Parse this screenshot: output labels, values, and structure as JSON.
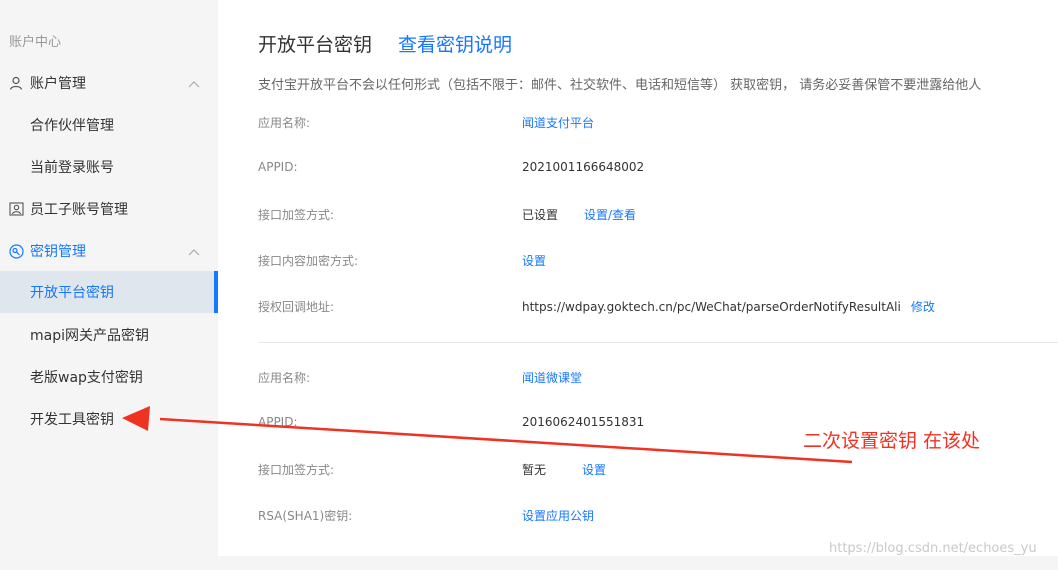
{
  "sidebar": {
    "header": "账户中心",
    "groups": [
      {
        "label": "账户管理",
        "icon": "user-icon"
      },
      {
        "label": "员工子账号管理",
        "icon": "staff-icon"
      },
      {
        "label": "密钥管理",
        "icon": "key-icon"
      }
    ],
    "items": [
      {
        "label": "合作伙伴管理"
      },
      {
        "label": "当前登录账号"
      },
      {
        "label": "开放平台密钥"
      },
      {
        "label": "mapi网关产品密钥"
      },
      {
        "label": "老版wap支付密钥"
      },
      {
        "label": "开发工具密钥"
      }
    ]
  },
  "main": {
    "title": "开放平台密钥",
    "title_link": "查看密钥说明",
    "description": "支付宝开放平台不会以任何形式（包括不限于：邮件、社交软件、电话和短信等） 获取密钥， 请务必妥善保管不要泄露给他人",
    "apps": [
      {
        "rows": [
          {
            "label": "应用名称:",
            "value": "闻道支付平台"
          },
          {
            "label": "APPID:",
            "value": "2021001166648002"
          },
          {
            "label": "接口加签方式:",
            "value": "已设置",
            "action": "设置/查看"
          },
          {
            "label": "接口内容加密方式:",
            "value": "设置"
          },
          {
            "label": "授权回调地址:",
            "value": "https://wdpay.goktech.cn/pc/WeChat/parseOrderNotifyResultAli",
            "action": "修改"
          }
        ]
      },
      {
        "rows": [
          {
            "label": "应用名称:",
            "value": "闻道微课堂"
          },
          {
            "label": "APPID:",
            "value": "2016062401551831"
          },
          {
            "label": "接口加签方式:",
            "value": "暂无",
            "action": "设置"
          },
          {
            "label": "RSA(SHA1)密钥:",
            "value": "设置应用公钥"
          }
        ]
      }
    ]
  },
  "annotation": {
    "note": "二次设置密钥 在该处",
    "color": "#ee3322"
  },
  "watermark": "https://blog.csdn.net/echoes_yu",
  "colors": {
    "accent": "#1677ff",
    "active_bg": "#dfe6ee"
  }
}
